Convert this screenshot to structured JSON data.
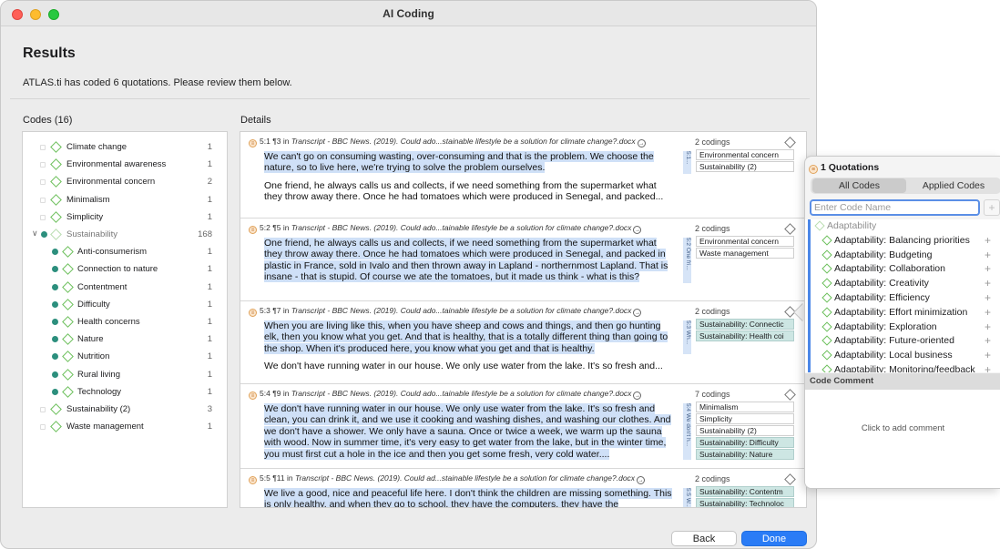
{
  "window": {
    "title": "AI Coding"
  },
  "results": {
    "title": "Results",
    "subtitle": "ATLAS.ti has coded 6 quotations. Please review them below."
  },
  "codes_label": "Codes (16)",
  "details_label": "Details",
  "codes": [
    {
      "name": "Climate change",
      "count": "1",
      "child": false
    },
    {
      "name": "Environmental awareness",
      "count": "1",
      "child": false
    },
    {
      "name": "Environmental concern",
      "count": "2",
      "child": false
    },
    {
      "name": "Minimalism",
      "count": "1",
      "child": false
    },
    {
      "name": "Simplicity",
      "count": "1",
      "child": false
    },
    {
      "name": "Sustainability",
      "count": "168",
      "child": false,
      "group": true
    },
    {
      "name": "Anti-consumerism",
      "count": "1",
      "child": true
    },
    {
      "name": "Connection to nature",
      "count": "1",
      "child": true
    },
    {
      "name": "Contentment",
      "count": "1",
      "child": true
    },
    {
      "name": "Difficulty",
      "count": "1",
      "child": true
    },
    {
      "name": "Health concerns",
      "count": "1",
      "child": true
    },
    {
      "name": "Nature",
      "count": "1",
      "child": true
    },
    {
      "name": "Nutrition",
      "count": "1",
      "child": true
    },
    {
      "name": "Rural living",
      "count": "1",
      "child": true
    },
    {
      "name": "Technology",
      "count": "1",
      "child": true
    },
    {
      "name": "Sustainability (2)",
      "count": "3",
      "child": false
    },
    {
      "name": "Waste management",
      "count": "1",
      "child": false
    }
  ],
  "quotations": [
    {
      "id": "5:1",
      "para": "¶3",
      "doc": "Transcript - BBC News. (2019). Could ado...stainable lifestyle be a solution for climate change?.docx",
      "codings": "2 codings",
      "side": "5:1...",
      "highlight": "We can't go on consuming wasting, over-consuming and that is the problem. We choose the nature, so to live here, we're trying to solve the problem ourselves.",
      "rest": "One friend, he always calls us and collects, if we need something from the supermarket what they throw away there. Once he had tomatoes which were produced in Senegal, and packed...",
      "tags": [
        "Environmental concern",
        "Sustainability (2)"
      ]
    },
    {
      "id": "5:2",
      "para": "¶5",
      "doc": "Transcript - BBC News. (2019). Could ado...tainable lifestyle be a solution for climate change?.docx",
      "codings": "2 codings",
      "side": "5:2 One fri...",
      "highlight": "One friend, he always calls us and collects, if we need something from the supermarket what they throw away there. Once he had tomatoes which were produced in Senegal, and packed in plastic in France, sold in Ivalo and then thrown away in Lapland - northernmost Lapland. That is insane - that is stupid. Of course we ate the tomatoes, but it made us think - what is this?",
      "rest": "",
      "tags": [
        "Environmental concern",
        "Waste management"
      ]
    },
    {
      "id": "5:3",
      "para": "¶7",
      "doc": "Transcript - BBC News. (2019). Could ado...tainable lifestyle be a solution for climate change?.docx",
      "codings": "2 codings",
      "side": "5:3 Wh...",
      "highlight": "When you are living like this, when you have sheep and cows and things, and then go hunting elk, then you know what you get. And that is healthy, that is a totally different thing than going to the shop. When it's produced here, you know what you get and that is healthy.",
      "rest": "We don't have running water in our house. We only use water from the lake. It's so fresh and...",
      "tags": [
        "Sustainability: Connectic",
        "Sustainability: Health coi"
      ]
    },
    {
      "id": "5:4",
      "para": "¶9",
      "doc": "Transcript - BBC News. (2019). Could ado...tainable lifestyle be a solution for climate change?.docx",
      "codings": "7 codings",
      "side": "5:4 We don't h...",
      "highlight": "We don't have running water in our house. We only use water from the lake. It's so fresh and clean, you can drink it, and we use it cooking and washing dishes, and washing our clothes. And we don't have a shower. We only have a sauna. Once or twice a week, we warm up the sauna with wood. Now in summer time, it's very easy to get water from the lake, but in the winter time, you must first cut a hole in the ice and then you get some fresh, very cold water....",
      "rest": "",
      "tags": [
        "Minimalism",
        "Simplicity",
        "Sustainability (2)",
        "Sustainability: Difficulty",
        "Sustainability: Nature"
      ]
    },
    {
      "id": "5:5",
      "para": "¶11",
      "doc": "Transcript - BBC News. (2019). Could ad...stainable lifestyle be a solution for climate change?.docx",
      "codings": "2 codings",
      "side": "5:5 W...",
      "highlight": "We live a good, nice and peaceful life here. I don't think the children are missing something. This is only healthy, and when they go to school, they have the computers, they have the",
      "rest": "",
      "tags": [
        "Sustainability: Contentm",
        "Sustainability: Technoloc"
      ]
    }
  ],
  "in_label": "in",
  "buttons": {
    "back": "Back",
    "done": "Done"
  },
  "popover": {
    "header": "1 Quotations",
    "tabs": [
      "All Codes",
      "Applied Codes"
    ],
    "search_placeholder": "Enter Code Name",
    "add": "+",
    "group": "Adaptability",
    "items": [
      "Adaptability: Balancing priorities",
      "Adaptability: Budgeting",
      "Adaptability: Collaboration",
      "Adaptability: Creativity",
      "Adaptability: Efficiency",
      "Adaptability: Effort minimization",
      "Adaptability: Exploration",
      "Adaptability: Future-oriented",
      "Adaptability: Local business",
      "Adaptability: Monitoring/feedback"
    ],
    "item_add": "+",
    "comment_header": "Code Comment",
    "comment_placeholder": "Click to add comment"
  }
}
